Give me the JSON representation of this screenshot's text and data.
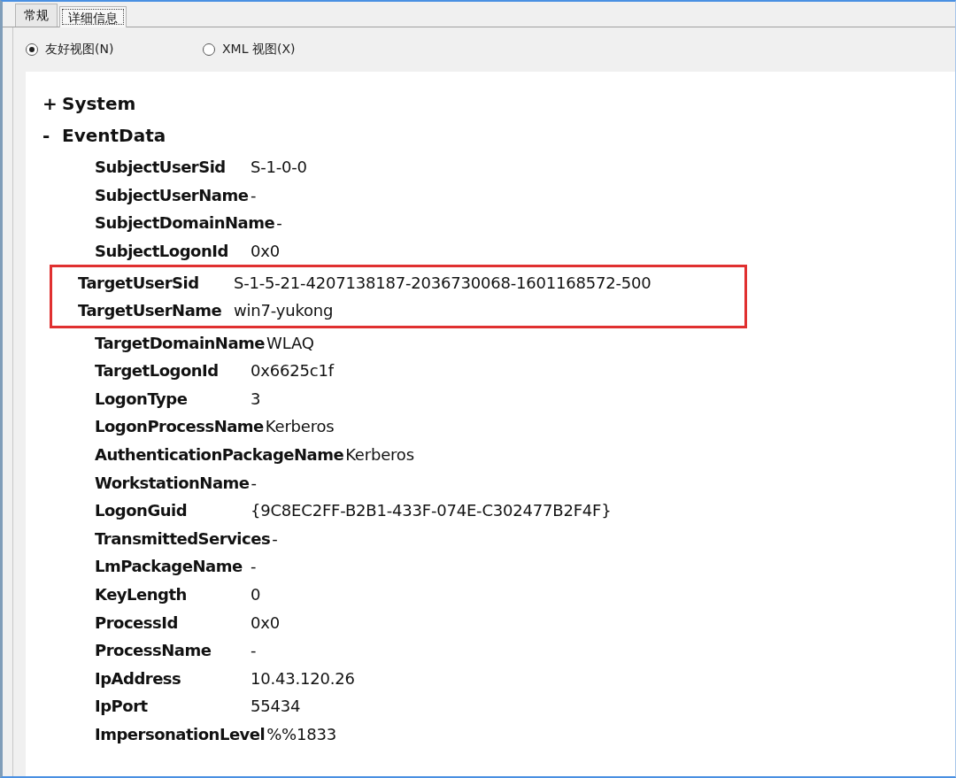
{
  "tabs": [
    {
      "label": "常规",
      "selected": false
    },
    {
      "label": "详细信息",
      "selected": true
    }
  ],
  "view_options": [
    {
      "label": "友好视图(N)",
      "selected": true
    },
    {
      "label": "XML 视图(X)",
      "selected": false
    }
  ],
  "tree": [
    {
      "toggle": "+",
      "label": "System"
    },
    {
      "toggle": "-",
      "label": "EventData",
      "fields": [
        {
          "name": "SubjectUserSid",
          "value": "S-1-0-0",
          "highlighted": false
        },
        {
          "name": "SubjectUserName",
          "value": "-",
          "highlighted": false
        },
        {
          "name": "SubjectDomainName",
          "value": "-",
          "highlighted": false
        },
        {
          "name": "SubjectLogonId",
          "value": "0x0",
          "highlighted": false
        },
        {
          "name": "TargetUserSid",
          "value": "S-1-5-21-4207138187-2036730068-1601168572-500",
          "highlighted": true
        },
        {
          "name": "TargetUserName",
          "value": "win7-yukong",
          "highlighted": true
        },
        {
          "name": "TargetDomainName",
          "value": "WLAQ",
          "highlighted": false
        },
        {
          "name": "TargetLogonId",
          "value": "0x6625c1f",
          "highlighted": false
        },
        {
          "name": "LogonType",
          "value": "3",
          "highlighted": false
        },
        {
          "name": "LogonProcessName",
          "value": "Kerberos",
          "highlighted": false
        },
        {
          "name": "AuthenticationPackageName",
          "value": "Kerberos",
          "highlighted": false
        },
        {
          "name": "WorkstationName",
          "value": "-",
          "highlighted": false
        },
        {
          "name": "LogonGuid",
          "value": "{9C8EC2FF-B2B1-433F-074E-C302477B2F4F}",
          "highlighted": false
        },
        {
          "name": "TransmittedServices",
          "value": "-",
          "highlighted": false
        },
        {
          "name": "LmPackageName",
          "value": "-",
          "highlighted": false
        },
        {
          "name": "KeyLength",
          "value": "0",
          "highlighted": false
        },
        {
          "name": "ProcessId",
          "value": "0x0",
          "highlighted": false
        },
        {
          "name": "ProcessName",
          "value": "-",
          "highlighted": false
        },
        {
          "name": "IpAddress",
          "value": "10.43.120.26",
          "highlighted": false
        },
        {
          "name": "IpPort",
          "value": "55434",
          "highlighted": false
        },
        {
          "name": "ImpersonationLevel",
          "value": "%%1833",
          "highlighted": false
        }
      ]
    }
  ]
}
